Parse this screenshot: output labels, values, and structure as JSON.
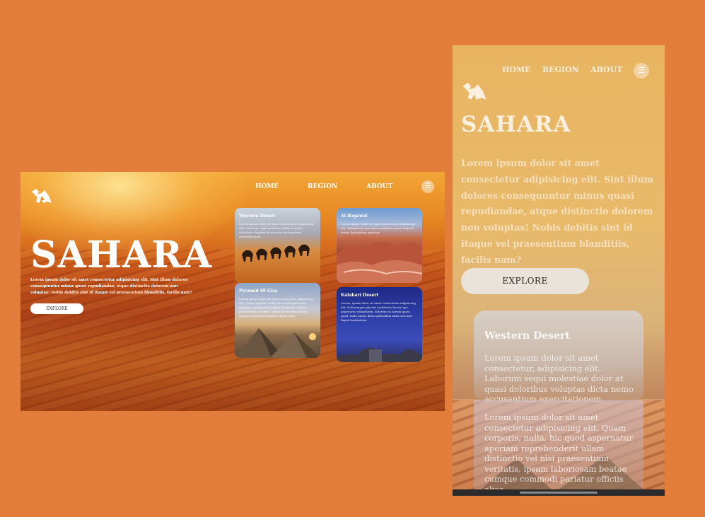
{
  "nav": {
    "home": "HOME",
    "region": "REGION",
    "about": "ABOUT",
    "menu_icon": "☰"
  },
  "hero": {
    "title": "SAHARA",
    "desktop_text": "Lorem ipsum dolor sit amet consectetur adipisicing elit. Sint illum dolores consequuntur minus quasi repudiandae, atque distinctio dolorem non voluptas! Nobis debitis sint id itaque vel praesentium blanditiis, facilis nam?",
    "mobile_text": "Lorem ipsum dolor sit amet consectetur adipisicing elit. Sint illum dolores consequuntur minus quasi repudiandae, atque distinctio dolorem non voluptas! Nobis debitis sint id itaque vel praesentium blanditiis, facilis nam?",
    "explore": "EXPLORE"
  },
  "cards": [
    {
      "title": "Western Desert",
      "text": "Lorem ipsum dolor sit amet consectetur, adipisicing elit. Laborum sequi molestiae dolor at quasi doloribus voluptas dicta nemo accusantium exercitationem."
    },
    {
      "title": "Al Bagawat",
      "text": "Lorem ipsum dolor sit amet consectetur adipisicing elit. Voluptatem quis iure numquam quasi tempore, ipsum laudantium aperiam."
    },
    {
      "title": "Pyramid Of Giza",
      "text": "Lorem ipsum dolor sit amet consectetur adipisicing elit. Quam corporis, nulla, hic quod aspernatur aperiam reprehenderit ullam distinctio vel nisi praesentium veritatis, ipsam laboriosam beatae cumque commodi pariatur officiis alias."
    },
    {
      "title": "Kalahari Desert",
      "text": "Lorem, ipsum dolor sit amet consectetur adipisicing elit. Doloremque placeat architecto facere quo asperiores voluptatem, dolorem ea harum quasi quod, nulla minus illum quibusdam alias nesciunt fugiat laudantium."
    }
  ],
  "mobile_cards": {
    "western_title": "Western Desert",
    "western_text": "Lorem ipsum dolor sit amet consectetur, adipisicing elit. Laborum sequi molestiae dolor at quasi doloribus voluptas dicta nemo accusantium exercitationem.",
    "pyramid_text": "Lorem ipsum dolor sit amet consectetur adipisicing elit. Quam corporis, nulla, hic quod aspernatur aperiam reprehenderit ullam distinctio vel nisi praesentium veritatis, ipsam laboriosam beatae cumque commodi pariatur officiis alias."
  },
  "colors": {
    "page_bg": "#e27d3b",
    "accent": "#ffffff"
  }
}
